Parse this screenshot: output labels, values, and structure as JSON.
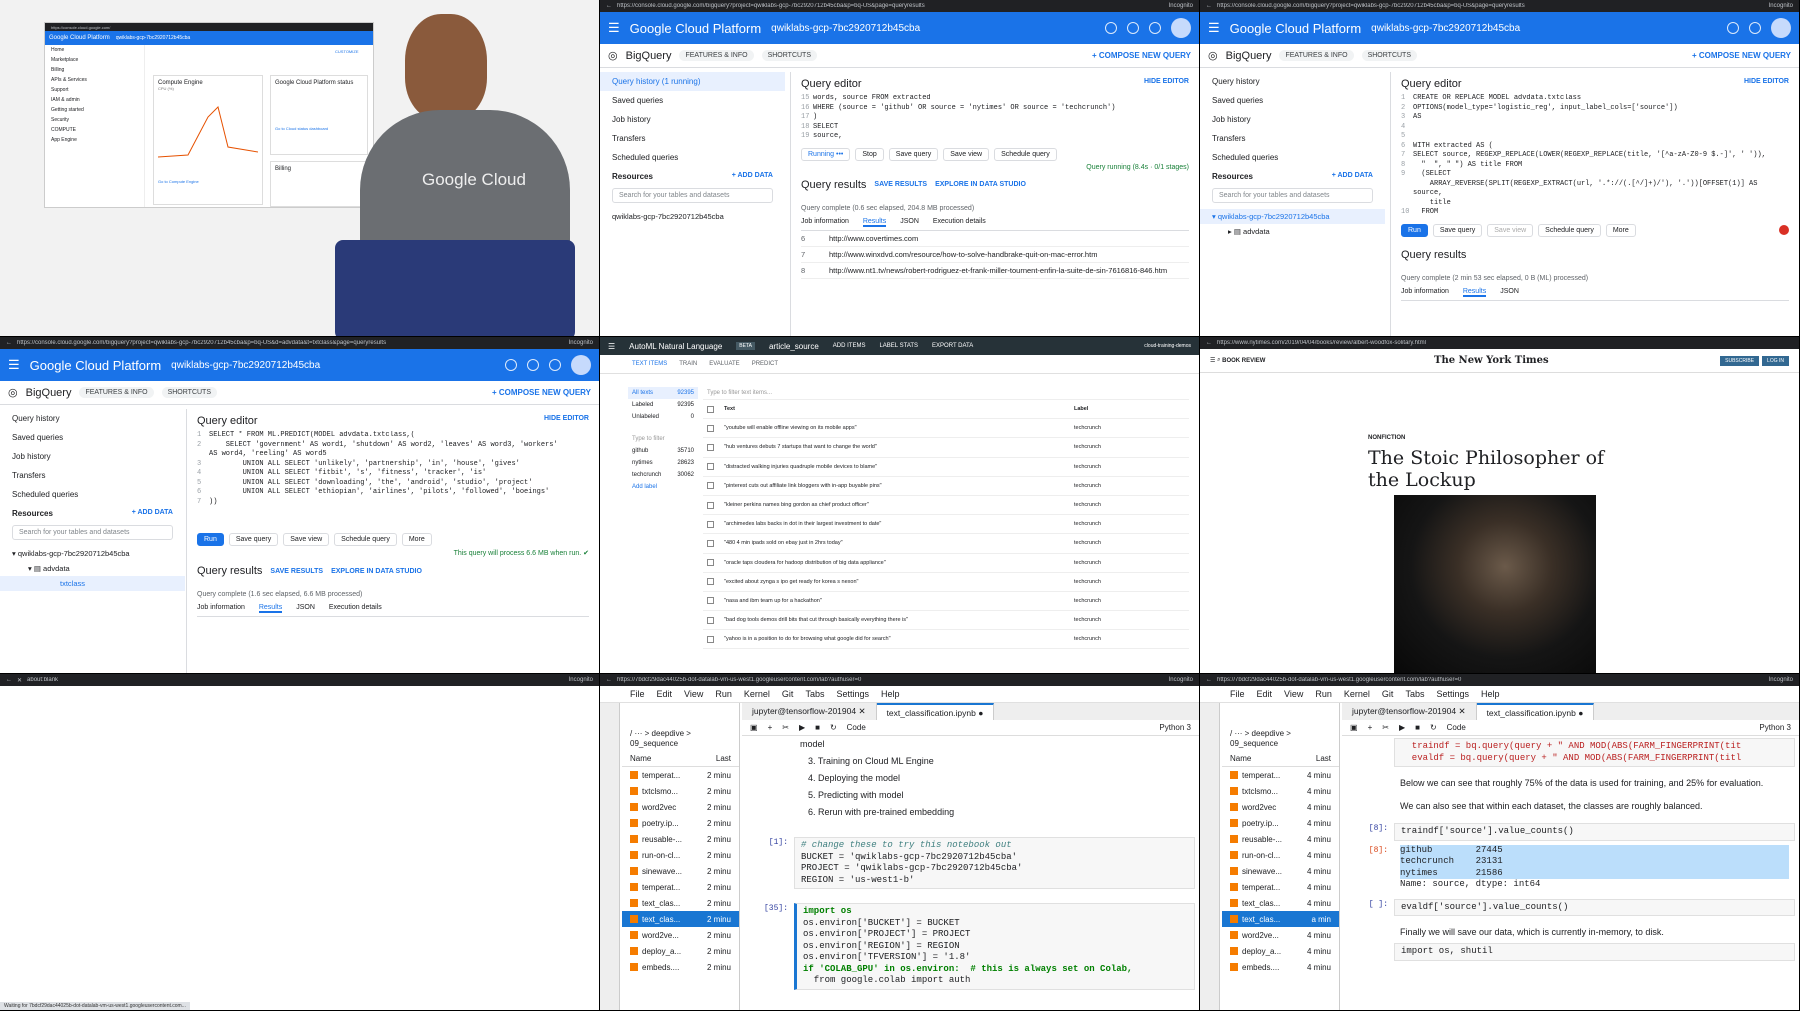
{
  "t1": {
    "inner_url": "https://console.cloud.google.com/",
    "brand": "Google Cloud Platform",
    "project": "qwiklabs-gcp-7bc2920712b45cba",
    "nav": [
      "Home",
      "Marketplace",
      "Billing",
      "APIs & Services",
      "Support",
      "IAM & admin",
      "Getting started",
      "Security",
      "COMPUTE",
      "App Engine"
    ],
    "customize": "CUSTOMIZE",
    "card1": "Compute Engine",
    "card1_sub": "CPU (%)",
    "card2": "Google Cloud Platform status",
    "card3": "Billing",
    "card2_link": "Go to Cloud status dashboard",
    "card1_link": "Go to Compute Engine",
    "shirt": "Google Cloud"
  },
  "t2": {
    "url": "https://console.cloud.google.com/bigquery?project=qwiklabs-gcp-7bc2920712b45cba&p=bq-US&page=queryresults",
    "incognito": "Incognito",
    "brand": "Google Cloud Platform",
    "project": "qwiklabs-gcp-7bc2920712b45cba",
    "app": "BigQuery",
    "features": "FEATURES & INFO",
    "shortcuts": "SHORTCUTS",
    "compose": "+ COMPOSE NEW QUERY",
    "side": [
      "Query history (1 running)",
      "Saved queries",
      "Job history",
      "Transfers",
      "Scheduled queries"
    ],
    "resources": "Resources",
    "add_data": "+ ADD DATA",
    "search": "Search for your tables and datasets",
    "project_node": "qwiklabs-gcp-7bc2920712b45cba",
    "editor": "Query editor",
    "hide": "HIDE EDITOR",
    "code": [
      [
        "15",
        "words, source FROM extracted"
      ],
      [
        "16",
        "WHERE (source = 'github' OR source = 'nytimes' OR source = 'techcrunch')"
      ],
      [
        "17",
        ")"
      ],
      [
        "18",
        "SELECT"
      ],
      [
        "19",
        "source,"
      ]
    ],
    "running": "Running",
    "stop": "Stop",
    "save_query": "Save query",
    "save_view": "Save view",
    "schedule": "Schedule query",
    "status": "Query running (8.4s · 0/1 stages)",
    "results": "Query results",
    "save_results": "SAVE RESULTS",
    "explore": "EXPLORE IN DATA STUDIO",
    "complete": "Query complete (0.6 sec elapsed, 204.8 MB processed)",
    "tabs": [
      "Job information",
      "Results",
      "JSON",
      "Execution details"
    ],
    "rows": [
      [
        "6",
        "http://www.covertimes.com"
      ],
      [
        "7",
        "http://www.winxdvd.com/resource/how-to-solve-handbrake-quit-on-mac-error.htm"
      ],
      [
        "8",
        "http://www.nt1.tv/news/robert-rodriguez-et-frank-miller-tournent-enfin-la-suite-de-sin-7616816-846.htm"
      ]
    ]
  },
  "t3": {
    "url": "https://console.cloud.google.com/bigquery?project=qwiklabs-gcp-7bc2920712b45cba&p=bq-US&page=queryresults",
    "incognito": "Incognito",
    "brand": "Google Cloud Platform",
    "project": "qwiklabs-gcp-7bc2920712b45cba",
    "app": "BigQuery",
    "features": "FEATURES & INFO",
    "shortcuts": "SHORTCUTS",
    "compose": "+ COMPOSE NEW QUERY",
    "side": [
      "Query history",
      "Saved queries",
      "Job history",
      "Transfers",
      "Scheduled queries"
    ],
    "resources": "Resources",
    "add_data": "+ ADD DATA",
    "search": "Search for your tables and datasets",
    "project_node": "qwiklabs-gcp-7bc2920712b45cba",
    "dataset": "advdata",
    "editor": "Query editor",
    "hide": "HIDE EDITOR",
    "code": [
      [
        "1",
        "CREATE OR REPLACE MODEL advdata.txtclass"
      ],
      [
        "2",
        "OPTIONS(model_type='logistic_reg', input_label_cols=['source'])"
      ],
      [
        "3",
        "AS"
      ],
      [
        "4",
        ""
      ],
      [
        "5",
        ""
      ],
      [
        "6",
        "WITH extracted AS ("
      ],
      [
        "7",
        "SELECT source, REGEXP_REPLACE(LOWER(REGEXP_REPLACE(title, '[^a-zA-Z0-9 $.-]', ' ')),"
      ],
      [
        "8",
        "  \"  \", \" \") AS title FROM"
      ],
      [
        "9",
        "  (SELECT"
      ],
      [
        "",
        "    ARRAY_REVERSE(SPLIT(REGEXP_EXTRACT(url, '.*://(.[^/]+)/'), '.'))[OFFSET(1)] AS"
      ],
      [
        "",
        "source,"
      ],
      [
        "",
        "    title"
      ],
      [
        "10",
        "  FROM"
      ]
    ],
    "run": "Run",
    "save_query": "Save query",
    "save_view": "Save view",
    "schedule": "Schedule query",
    "more": "More",
    "results": "Query results",
    "complete": "Query complete (2 min 53 sec elapsed, 0 B (ML) processed)",
    "tabs": [
      "Job information",
      "Results",
      "JSON"
    ]
  },
  "t4": {
    "url": "https://console.cloud.google.com/bigquery?project=qwiklabs-gcp-7bc2920712b45cba&p=bq-US&d=advdata&t=txtclass&page=queryresults",
    "incognito": "Incognito",
    "brand": "Google Cloud Platform",
    "project": "qwiklabs-gcp-7bc2920712b45cba",
    "app": "BigQuery",
    "features": "FEATURES & INFO",
    "shortcuts": "SHORTCUTS",
    "compose": "+ COMPOSE NEW QUERY",
    "side": [
      "Query history",
      "Saved queries",
      "Job history",
      "Transfers",
      "Scheduled queries"
    ],
    "resources": "Resources",
    "add_data": "+ ADD DATA",
    "search": "Search for your tables and datasets",
    "project_node": "qwiklabs-gcp-7bc2920712b45cba",
    "dataset": "advdata",
    "table": "txtclass",
    "editor": "Query editor",
    "hide": "HIDE EDITOR",
    "code": [
      [
        "1",
        "SELECT * FROM ML.PREDICT(MODEL advdata.txtclass,("
      ],
      [
        "2",
        "    SELECT 'government' AS word1, 'shutdown' AS word2, 'leaves' AS word3, 'workers'"
      ],
      [
        "",
        "AS word4, 'reeling' AS word5"
      ],
      [
        "3",
        "        UNION ALL SELECT 'unlikely', 'partnership', 'in', 'house', 'gives'"
      ],
      [
        "4",
        "        UNION ALL SELECT 'fitbit', 's', 'fitness', 'tracker', 'is'"
      ],
      [
        "5",
        "        UNION ALL SELECT 'downloading', 'the', 'android', 'studio', 'project'"
      ],
      [
        "6",
        "        UNION ALL SELECT 'ethiopian', 'airlines', 'pilots', 'followed', 'boeings'"
      ],
      [
        "7",
        "))"
      ]
    ],
    "run": "Run",
    "save_query": "Save query",
    "save_view": "Save view",
    "schedule": "Schedule query",
    "more": "More",
    "status": "This query will process 6.6 MB when run.",
    "results": "Query results",
    "save_results": "SAVE RESULTS",
    "explore": "EXPLORE IN DATA STUDIO",
    "complete": "Query complete (1.6 sec elapsed, 6.6 MB processed)",
    "tabs": [
      "Job information",
      "Results",
      "JSON",
      "Execution details"
    ]
  },
  "t5": {
    "app": "AutoML Natural Language",
    "beta": "BETA",
    "dataset": "article_source",
    "actions": [
      "ADD ITEMS",
      "LABEL STATS",
      "EXPORT DATA"
    ],
    "account": "cloud-training-demos",
    "tabs": [
      "TEXT ITEMS",
      "TRAIN",
      "EVALUATE",
      "PREDICT"
    ],
    "filters": [
      [
        "All texts",
        "92395"
      ],
      [
        "Labeled",
        "92395"
      ],
      [
        "Unlabeled",
        "0"
      ]
    ],
    "type_filter": "Type to filter",
    "labels": [
      [
        "github",
        "35710"
      ],
      [
        "nytimes",
        "28623"
      ],
      [
        "techcrunch",
        "30062"
      ]
    ],
    "add_label": "Add label",
    "table_filter": "Type to filter text items...",
    "col_text": "Text",
    "col_label": "Label",
    "rows": [
      [
        "\"youtube will enable offline viewing on its mobile apps\"",
        "techcrunch"
      ],
      [
        "\"hub ventures debuts 7 startups that want to change the world\"",
        "techcrunch"
      ],
      [
        "\"distracted walking injuries quadruple mobile devices to blame\"",
        "techcrunch"
      ],
      [
        "\"pinterest cuts out affiliate link bloggers with in-app buyable pins\"",
        "techcrunch"
      ],
      [
        "\"kleiner perkins names bing gordon as chief product officer\"",
        "techcrunch"
      ],
      [
        "\"archimedes labs backs in dot in their largest investment to date\"",
        "techcrunch"
      ],
      [
        "\"480 4 min ipads sold on ebay just in 2hrs today\"",
        "techcrunch"
      ],
      [
        "\"oracle taps cloudera for hadoop distribution of big data appliance\"",
        "techcrunch"
      ],
      [
        "\"excited about zynga s ipo get ready for korea s nexon\"",
        "techcrunch"
      ],
      [
        "\"nasa and ibm team up for a hackathon\"",
        "techcrunch"
      ],
      [
        "\"bad dog tools demos drill bits that cut through basically everything there is\"",
        "techcrunch"
      ],
      [
        "\"yahoo is in a position to do for browsing what google did for search\"",
        "techcrunch"
      ]
    ]
  },
  "t6": {
    "url": "https://www.nytimes.com/2019/04/04/books/review/albert-woodfox-solitary.html",
    "section": "BOOK REVIEW",
    "logo": "The New York Times",
    "subscribe": "SUBSCRIBE",
    "login": "LOG IN",
    "kicker": "NONFICTION",
    "title": "The Stoic Philosopher of the Lockup"
  },
  "t7": {
    "url": "about:blank",
    "incognito": "Incognito",
    "status": "Waiting for 7bdcf29dac44025b-dot-datalab-vm-us-west1.googleusercontent.com..."
  },
  "t8": {
    "url": "https://7bdcf29dac44025b-dot-datalab-vm-us-west1.googleusercontent.com/lab?authuser=0",
    "incognito": "Incognito",
    "menu": [
      "File",
      "Edit",
      "View",
      "Run",
      "Kernel",
      "Git",
      "Tabs",
      "Settings",
      "Help"
    ],
    "crumb": "/ ··· > deepdive > 09_sequence",
    "col_name": "Name",
    "col_last": "Last",
    "files": [
      [
        "temperat...",
        "2 minu"
      ],
      [
        "txtclsmo...",
        "2 minu"
      ],
      [
        "word2vec",
        "2 minu"
      ],
      [
        "poetry.ip...",
        "2 minu"
      ],
      [
        "reusable-...",
        "2 minu"
      ],
      [
        "run-on-cl...",
        "2 minu"
      ],
      [
        "sinewave...",
        "2 minu"
      ],
      [
        "temperat...",
        "2 minu"
      ],
      [
        "text_clas...",
        "2 minu"
      ],
      [
        "text_clas...",
        "2 minu"
      ],
      [
        "word2ve...",
        "2 minu"
      ],
      [
        "deploy_a...",
        "2 minu"
      ],
      [
        "embeds....",
        "2 minu"
      ]
    ],
    "tab1": "jupyter@tensorflow-201904",
    "tab2": "text_classification.ipynb",
    "celltype": "Code",
    "kernel": "Python 3",
    "md": [
      "model",
      "3. Training on Cloud ML Engine",
      "4. Deploying the model",
      "5. Predicting with model",
      "6. Rerun with pre-trained embedding"
    ],
    "p1": "[1]:",
    "c1": [
      "# change these to try this notebook out",
      "BUCKET = 'qwiklabs-gcp-7bc2920712b45cba'",
      "PROJECT = 'qwiklabs-gcp-7bc2920712b45cba'",
      "REGION = 'us-west1-b'"
    ],
    "p2": "[35]:",
    "c2": [
      "import os",
      "os.environ['BUCKET'] = BUCKET",
      "os.environ['PROJECT'] = PROJECT",
      "os.environ['REGION'] = REGION",
      "os.environ['TFVERSION'] = '1.8'",
      "",
      "if 'COLAB_GPU' in os.environ:  # this is always set on Colab,",
      "  from google.colab import auth"
    ]
  },
  "t9": {
    "url": "https://7bdcf29dac44025b-dot-datalab-vm-us-west1.googleusercontent.com/lab?authuser=0",
    "incognito": "Incognito",
    "menu": [
      "File",
      "Edit",
      "View",
      "Run",
      "Kernel",
      "Git",
      "Tabs",
      "Settings",
      "Help"
    ],
    "crumb": "/ ··· > deepdive > 09_sequence",
    "col_name": "Name",
    "col_last": "Last",
    "files": [
      [
        "temperat...",
        "4 minu"
      ],
      [
        "txtclsmo...",
        "4 minu"
      ],
      [
        "word2vec",
        "4 minu"
      ],
      [
        "poetry.ip...",
        "4 minu"
      ],
      [
        "reusable-...",
        "4 minu"
      ],
      [
        "run-on-cl...",
        "4 minu"
      ],
      [
        "sinewave...",
        "4 minu"
      ],
      [
        "temperat...",
        "4 minu"
      ],
      [
        "text_clas...",
        "4 minu"
      ],
      [
        "text_clas...",
        "a min"
      ],
      [
        "word2ve...",
        "4 minu"
      ],
      [
        "deploy_a...",
        "4 minu"
      ],
      [
        "embeds....",
        "4 minu"
      ]
    ],
    "tab1": "jupyter@tensorflow-201904",
    "tab2": "text_classification.ipynb",
    "celltype": "Code",
    "kernel": "Python 3",
    "c0": [
      "  traindf = bq.query(query + \" AND MOD(ABS(FARM_FINGERPRINT(tit",
      "  evaldf = bq.query(query + \" AND MOD(ABS(FARM_FINGERPRINT(titl"
    ],
    "md1": "Below we can see that roughly 75% of the data is used for training, and 25% for evaluation.",
    "md2": "We can also see that within each dataset, the classes are roughly balanced.",
    "p1": "[8]:",
    "c1": "traindf['source'].value_counts()",
    "out": [
      "github        27445",
      "techcrunch    23131",
      "nytimes       21586",
      "Name: source, dtype: int64"
    ],
    "p2": "[ ]:",
    "c2": "evaldf['source'].value_counts()",
    "md3": "Finally we will save our data, which is currently in-memory, to disk.",
    "c3": "import os, shutil"
  }
}
